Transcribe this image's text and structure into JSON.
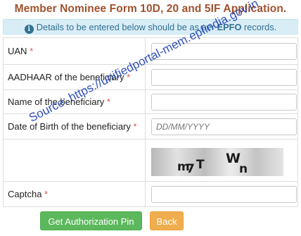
{
  "title": "Member Nominee Form 10D, 20 and 5IF Application.",
  "info": {
    "text_before": "Details to be entered below should be as per",
    "highlight": "EPFO",
    "text_after": "records."
  },
  "fields": [
    {
      "label": "UAN",
      "required": "*",
      "value": "",
      "placeholder": ""
    },
    {
      "label": "AADHAAR of the beneficiary",
      "required": "*",
      "value": "",
      "placeholder": ""
    },
    {
      "label": "Name of the beneficiary",
      "required": "*",
      "value": "",
      "placeholder": ""
    },
    {
      "label": "Date of Birth of the beneficiary",
      "required": "*",
      "value": "",
      "placeholder": "DD/MM/YYYY"
    }
  ],
  "captcha": {
    "image_text": [
      "m",
      "7",
      "T",
      "W",
      "n"
    ],
    "label": "Captcha",
    "required": "*",
    "value": ""
  },
  "buttons": {
    "get_pin": "Get Authorization Pin",
    "back": "Back"
  },
  "watermark": "Source: https://unifiedportal-mem.epfindia.gov.in",
  "colors": {
    "title": "#a0522d",
    "info_bg": "#d9edf7",
    "info_text": "#31708f",
    "required": "#d9534f",
    "btn_green": "#5cb85c",
    "btn_orange": "#f0ad4e",
    "watermark": "#1b3fb3"
  },
  "icons": {
    "info": "info-circle-icon"
  }
}
